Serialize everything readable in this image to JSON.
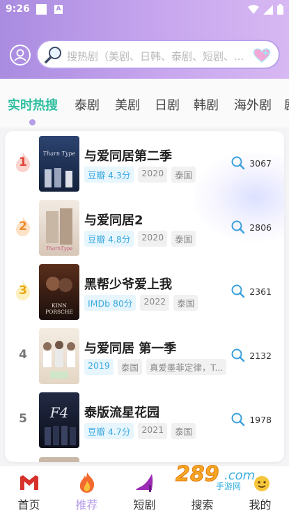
{
  "status_bar": {
    "time": "9:26",
    "badge": "A"
  },
  "search": {
    "placeholder": "搜热剧（美剧、日韩、泰剧、短剧、..."
  },
  "tabs": [
    {
      "label": "实时热搜",
      "active": true
    },
    {
      "label": "泰剧"
    },
    {
      "label": "美剧"
    },
    {
      "label": "日剧"
    },
    {
      "label": "韩剧"
    },
    {
      "label": "海外剧"
    },
    {
      "label": "剧"
    }
  ],
  "list": [
    {
      "rank": "1",
      "title": "与爱同居第二季",
      "score": "豆瓣 4.3分",
      "year": "2020",
      "region": "泰国",
      "hot": "3067",
      "poster_text": "TharnType",
      "poster_color": "#1c2e50"
    },
    {
      "rank": "2",
      "title": "与爱同居2",
      "score": "豆瓣 4.8分",
      "year": "2020",
      "region": "泰国",
      "hot": "2806",
      "poster_text": "TharnType",
      "poster_color": "#e9ddd2"
    },
    {
      "rank": "3",
      "title": "黑帮少爷爱上我",
      "score": "IMDb 80分",
      "year": "2022",
      "region": "泰国",
      "hot": "2361",
      "poster_text": "KINNPORSCHE",
      "poster_color": "#2b1a14"
    },
    {
      "rank": "4",
      "title": "与爱同居 第一季",
      "score": "2019",
      "year": "泰国",
      "region": "真爱墨菲定律，T...",
      "hot": "2132",
      "poster_text": "",
      "poster_color": "#efe4d6"
    },
    {
      "rank": "5",
      "title": "泰版流星花园",
      "score": "豆瓣 4.7分",
      "year": "2021",
      "region": "泰国",
      "hot": "1978",
      "poster_text": "F4",
      "poster_color": "#161a2a"
    }
  ],
  "nav": [
    {
      "label": "首页",
      "icon": "gmail-m-icon"
    },
    {
      "label": "推荐",
      "icon": "fire-icon",
      "active": true
    },
    {
      "label": "短剧",
      "icon": "high-heel-icon"
    },
    {
      "label": "搜索",
      "icon": "search-icon"
    },
    {
      "label": "我的",
      "icon": "smiley-icon"
    }
  ],
  "watermark": "289 手游网"
}
